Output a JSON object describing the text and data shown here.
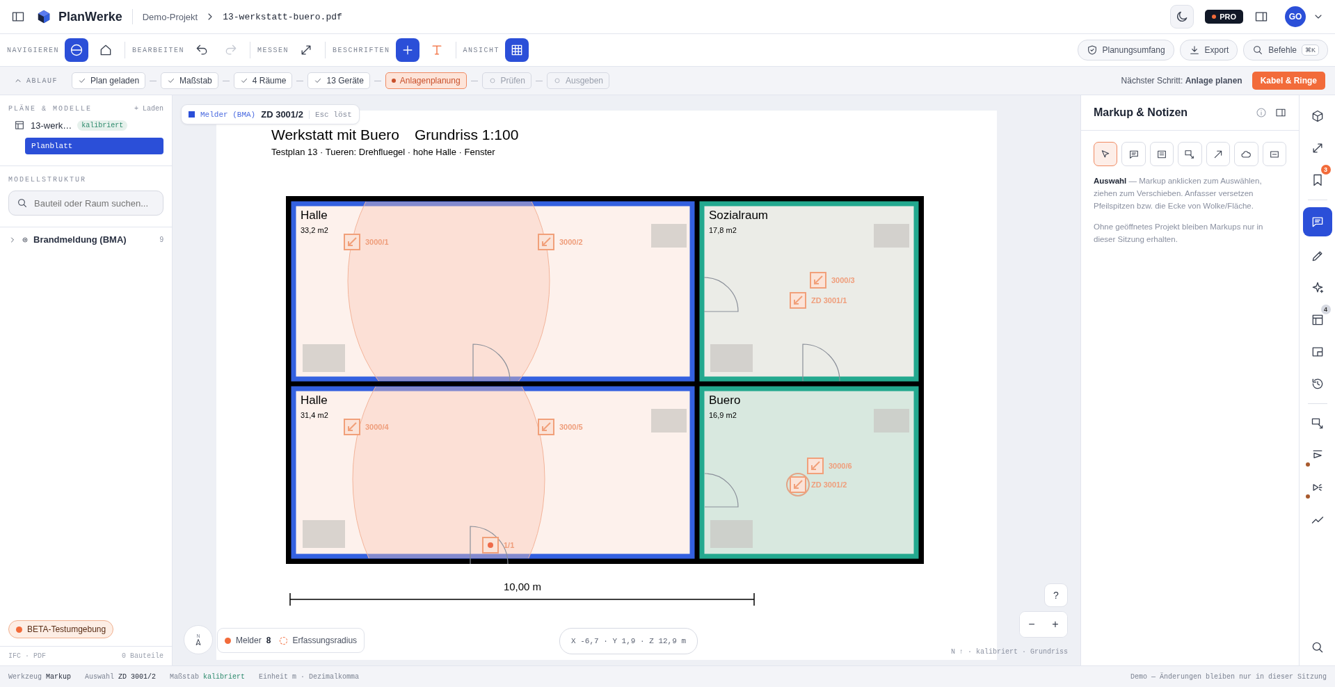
{
  "header": {
    "app_name": "PlanWerke",
    "breadcrumb": [
      "Demo-Projekt",
      "13-werkstatt-buero.pdf"
    ],
    "plan_badge": "PRO",
    "avatar": "GO"
  },
  "toolbar": {
    "groups": [
      {
        "label": "NAVIGIEREN",
        "tools": [
          {
            "kind": "circle-minus",
            "active": true,
            "disabled": false
          },
          {
            "kind": "home",
            "active": false,
            "disabled": false
          }
        ]
      },
      {
        "label": "BEARBEITEN",
        "tools": [
          {
            "kind": "undo",
            "active": false,
            "disabled": false
          },
          {
            "kind": "redo",
            "active": false,
            "disabled": true
          }
        ]
      },
      {
        "label": "MESSEN",
        "tools": [
          {
            "kind": "diagonal-arrows",
            "active": false,
            "disabled": false
          }
        ]
      },
      {
        "label": "BESCHRIFTEN",
        "tools": [
          {
            "kind": "plus",
            "active": true,
            "disabled": false
          },
          {
            "kind": "text",
            "active": false,
            "disabled": false
          }
        ]
      },
      {
        "label": "ANSICHT",
        "tools": [
          {
            "kind": "grid",
            "active": true,
            "disabled": false
          }
        ]
      }
    ],
    "actions": [
      {
        "kind": "shield",
        "label": "Planungsumfang"
      },
      {
        "kind": "download",
        "label": "Export"
      },
      {
        "kind": "search",
        "label": "Befehle",
        "shortcut": "⌘K"
      }
    ]
  },
  "workflow": {
    "label": "ABLAUF",
    "expanded": true,
    "steps": [
      {
        "label": "Plan geladen",
        "kind": "done"
      },
      {
        "label": "Maßstab",
        "kind": "done"
      },
      {
        "label": "4 Räume",
        "kind": "done"
      },
      {
        "label": "13 Geräte",
        "kind": "done"
      },
      {
        "label": "Anlagenplanung",
        "kind": "active"
      },
      {
        "label": "Prüfen",
        "kind": "todo"
      },
      {
        "label": "Ausgeben",
        "kind": "todo"
      }
    ],
    "next_step": "Nächster Schritt: **Anlage planen**",
    "next_button": "Kabel & Ringe"
  },
  "sidebar": {
    "plans_heading": "PLÄNE & MODELLE",
    "load_button": "+ Laden",
    "plans": [
      {
        "name": "13-werk…",
        "badge": "kalibriert",
        "sheets": [
          {
            "label": "Planblatt",
            "selected": true
          }
        ]
      }
    ],
    "structure_heading": "MODELLSTRUKTUR",
    "search": {
      "placeholder": "Bauteil oder Raum suchen..."
    },
    "tree": [
      {
        "label": "Brandmeldung (BMA)",
        "count": "9",
        "expanded": false
      }
    ],
    "footer_left": "IFC · PDF",
    "footer_right": "0 Bauteile"
  },
  "canvas": {
    "selection": {
      "category": "Melder (BMA)",
      "id": "ZD 3001/2",
      "hint": "Esc löst"
    },
    "sheet": {
      "title": "Werkstatt mit Buero",
      "title_2": "Grundriss 1:100",
      "subtitle": "Testplan 13 · Tueren: Drehfluegel · hohe Halle · Fenster",
      "rooms": [
        {
          "name": "Halle",
          "area": "33,2 m2",
          "color": "#3461e0"
        },
        {
          "name": "Sozialraum",
          "area": "17,8 m2",
          "color": "#23a98f"
        },
        {
          "name": "Halle",
          "area": "31,4 m2",
          "color": "#3461e0"
        },
        {
          "name": "Buero",
          "area": "16,9 m2",
          "color": "#23a98f"
        }
      ],
      "devices": [
        {
          "label": "3000/1",
          "kind": "detector",
          "selected": false
        },
        {
          "label": "3000/2",
          "kind": "detector",
          "selected": false
        },
        {
          "label": "3000/3",
          "kind": "detector",
          "selected": false
        },
        {
          "label": "ZD 3001/1",
          "kind": "detector",
          "selected": false
        },
        {
          "label": "3000/4",
          "kind": "detector",
          "selected": false
        },
        {
          "label": "3000/5",
          "kind": "detector",
          "selected": false
        },
        {
          "label": "3000/6",
          "kind": "detector",
          "selected": false
        },
        {
          "label": "ZD 3001/2",
          "kind": "detector",
          "selected": true
        },
        {
          "label": "1/1",
          "kind": "call-point",
          "selected": false
        }
      ],
      "scale_label": "10,00 m"
    },
    "compass": "N",
    "legend": {
      "label": "Melder",
      "count": "8",
      "radius_label": "Erfassungsradius"
    },
    "coordinates": "X -6,7 · Y 1,9 · Z 12,9 m",
    "help": "?",
    "zoom": [
      "−",
      "+"
    ],
    "footer": "N ↑ · kalibriert · Grundriss"
  },
  "right_panel": {
    "title": "Markup & Notizen",
    "tools": [
      {
        "kind": "cursor",
        "selected": true
      },
      {
        "kind": "comment",
        "selected": false
      },
      {
        "kind": "note",
        "selected": false
      },
      {
        "kind": "box-arrow",
        "selected": false
      },
      {
        "kind": "arrow",
        "selected": false
      },
      {
        "kind": "cloud",
        "selected": false
      },
      {
        "kind": "dashed-box",
        "selected": false
      }
    ],
    "description": "**Auswahl** — Markup anklicken zum Auswählen, ziehen zum Verschieben. Anfasser versetzen Pfeilspitzen bzw. die Ecke von Wolke/Fläche.",
    "note": "Ohne geöffnetes Projekt bleiben Markups nur in dieser Sitzung erhalten."
  },
  "rail": {
    "groups": [
      [
        {
          "kind": "cube",
          "selected": false,
          "marked": false
        },
        {
          "kind": "diagonal-arrows",
          "selected": false,
          "marked": false
        },
        {
          "kind": "bookmark",
          "selected": false,
          "marked": false,
          "badge": "3",
          "color": "#f26b3a"
        }
      ],
      [
        {
          "kind": "comment",
          "selected": true,
          "marked": false
        },
        {
          "kind": "pencil",
          "selected": false,
          "marked": false
        },
        {
          "kind": "sparkle",
          "selected": false,
          "marked": false
        },
        {
          "kind": "table",
          "selected": false,
          "marked": false,
          "badge": "4",
          "color": "#d6d9e1"
        },
        {
          "kind": "picture-in-picture",
          "selected": false,
          "marked": false
        },
        {
          "kind": "history",
          "selected": false,
          "marked": false
        }
      ],
      [
        {
          "kind": "box-arrow",
          "selected": false,
          "marked": false
        },
        {
          "kind": "flag",
          "selected": false,
          "marked": true
        },
        {
          "kind": "speaker",
          "selected": false,
          "marked": true
        },
        {
          "kind": "trend-line",
          "selected": false,
          "marked": false
        }
      ]
    ]
  },
  "status_bar": {
    "items": [
      {
        "label": "Werkzeug",
        "value": "Markup",
        "kind": "plain"
      },
      {
        "label": "Auswahl",
        "value": "ZD 3001/2",
        "kind": "plain"
      },
      {
        "label": "Maßstab",
        "value": "kalibriert",
        "kind": "ok"
      },
      {
        "label": "Einheit m · Dezimalkomma",
        "kind": "text"
      }
    ],
    "notice": "Demo — Änderungen bleiben nur in dieser Sitzung"
  },
  "beta_badge": "BETA-Testumgebung"
}
